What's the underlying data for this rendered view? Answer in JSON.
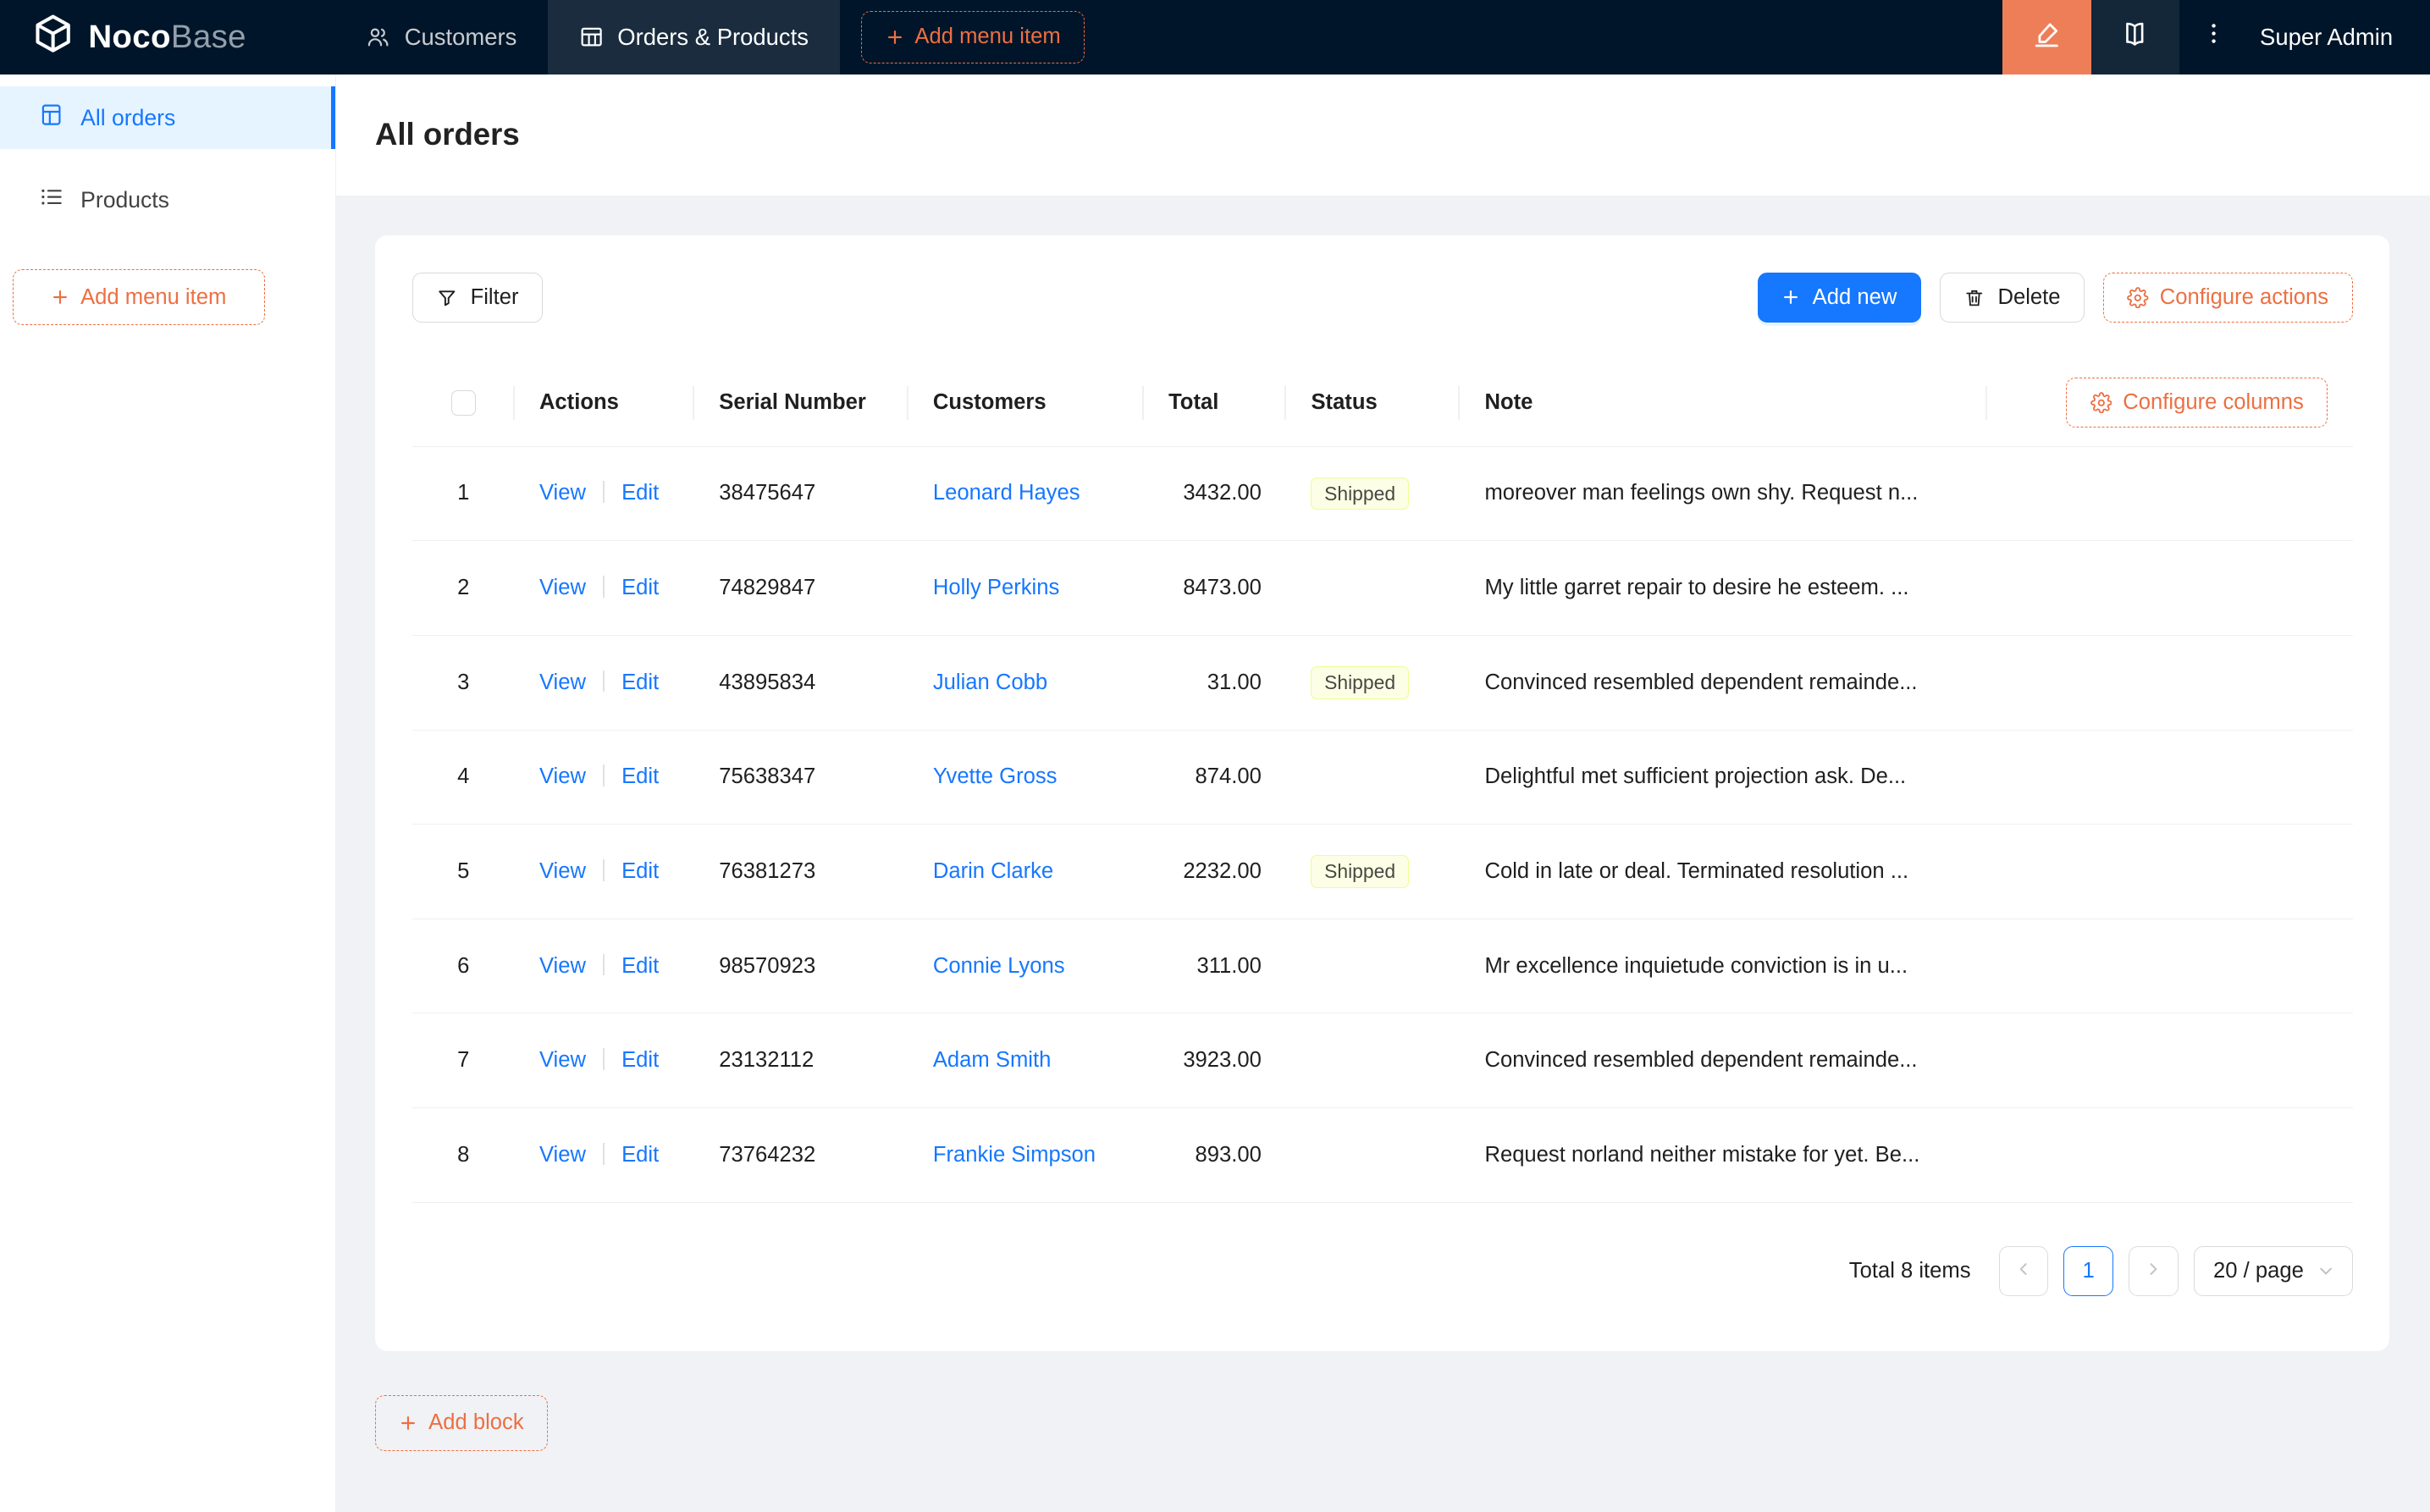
{
  "navbar": {
    "logo_bold": "Noco",
    "logo_light": "Base",
    "items": [
      {
        "label": "Customers"
      },
      {
        "label": "Orders & Products"
      }
    ],
    "add_menu_item": "Add menu item",
    "user": "Super Admin"
  },
  "sidebar": {
    "items": [
      {
        "label": "All orders"
      },
      {
        "label": "Products"
      }
    ],
    "add_menu_item": "Add menu item"
  },
  "page": {
    "title": "All orders",
    "add_block_label": "Add block"
  },
  "toolbar": {
    "filter": "Filter",
    "add_new": "Add new",
    "delete": "Delete",
    "configure_actions": "Configure actions"
  },
  "table": {
    "configure_columns": "Configure columns",
    "headers": [
      "Actions",
      "Serial Number",
      "Customers",
      "Total",
      "Status",
      "Note"
    ],
    "actions": {
      "view": "View",
      "edit": "Edit"
    },
    "rows": [
      {
        "index": "1",
        "serial": "38475647",
        "customer": "Leonard Hayes",
        "total": "3432.00",
        "status": "Shipped",
        "note": "moreover man feelings own shy. Request n..."
      },
      {
        "index": "2",
        "serial": "74829847",
        "customer": "Holly Perkins",
        "total": "8473.00",
        "status": "",
        "note": "My little garret repair to desire he esteem. ..."
      },
      {
        "index": "3",
        "serial": "43895834",
        "customer": "Julian Cobb",
        "total": "31.00",
        "status": "Shipped",
        "note": "Convinced resembled dependent remainde..."
      },
      {
        "index": "4",
        "serial": "75638347",
        "customer": "Yvette Gross",
        "total": "874.00",
        "status": "",
        "note": "Delightful met sufficient projection ask. De..."
      },
      {
        "index": "5",
        "serial": "76381273",
        "customer": "Darin Clarke",
        "total": "2232.00",
        "status": "Shipped",
        "note": "Cold in late or deal. Terminated resolution ..."
      },
      {
        "index": "6",
        "serial": "98570923",
        "customer": "Connie Lyons",
        "total": "311.00",
        "status": "",
        "note": "Mr excellence inquietude conviction is in u..."
      },
      {
        "index": "7",
        "serial": "23132112",
        "customer": "Adam Smith",
        "total": "3923.00",
        "status": "",
        "note": "Convinced resembled dependent remainde..."
      },
      {
        "index": "8",
        "serial": "73764232",
        "customer": "Frankie Simpson",
        "total": "893.00",
        "status": "",
        "note": "Request norland neither mistake for yet. Be..."
      }
    ]
  },
  "pagination": {
    "total_text": "Total 8 items",
    "current_page": "1",
    "page_size": "20 / page"
  },
  "colors": {
    "accent_orange": "#ed6f42",
    "primary_blue": "#1677ff",
    "navbar_bg": "#001529",
    "sidebar_selected_bg": "#e6f4ff",
    "status_tag_bg": "#fcffe6",
    "status_tag_border": "#eaff8f"
  }
}
